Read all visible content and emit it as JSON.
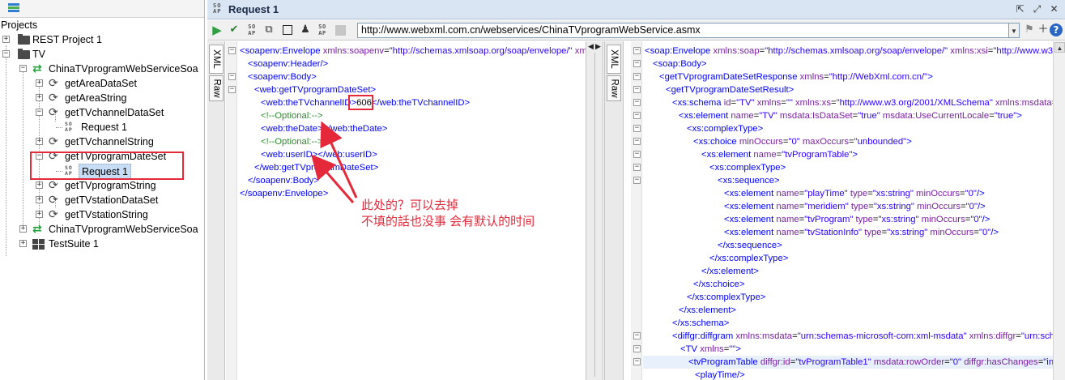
{
  "navigator": {
    "heading": "Projects",
    "items": [
      {
        "label": "REST Project 1"
      },
      {
        "label": "TV"
      },
      {
        "label": "ChinaTVprogramWebServiceSoa"
      },
      {
        "label": "getAreaDataSet"
      },
      {
        "label": "getAreaString"
      },
      {
        "label": "getTVchannelDataSet"
      },
      {
        "label": "Request 1"
      },
      {
        "label": "getTVchannelString"
      },
      {
        "label": "getTVprogramDateSet"
      },
      {
        "label": "Request 1"
      },
      {
        "label": "getTVprogramString"
      },
      {
        "label": "getTVstationDataSet"
      },
      {
        "label": "getTVstationString"
      },
      {
        "label": "ChinaTVprogramWebServiceSoa"
      },
      {
        "label": "TestSuite 1"
      }
    ]
  },
  "window": {
    "soap_badge": "SO AP",
    "title": "Request 1"
  },
  "toolbar": {
    "endpoint": "http://www.webxml.com.cn/webservices/ChinaTVprogramWebService.asmx"
  },
  "tabs": {
    "xml": "XML",
    "raw": "Raw"
  },
  "request_xml": {
    "l1": {
      "t1": "<soapenv:Envelope",
      "a1": "xmlns:soapenv",
      "v1": "\"http://schemas.xmlsoap.org/soap/envelope/\"",
      "a2": "xmlns:"
    },
    "l2": "<soapenv:Header/>",
    "l3": "<soapenv:Body>",
    "l4": "<web:getTVprogramDateSet>",
    "l5": {
      "open": "<web:theTVchannelID>",
      "value": "606",
      "close": "</web:theTVchannelID>"
    },
    "l6": "<!--Optional:-->",
    "l7": {
      "open": "<web:theDate>",
      "close": "</web:theDate>"
    },
    "l8": "<!--Optional:-->",
    "l9": {
      "open": "<web:userID>",
      "close": "</web:userID>"
    },
    "l10": "</web:getTVprogramDateSet>",
    "l11": "</soapenv:Body>",
    "l12": "</soapenv:Envelope>"
  },
  "response_xml": {
    "r1": {
      "t": "<soap:Envelope",
      "a1": "xmlns:soap",
      "v1": "\"http://schemas.xmlsoap.org/soap/envelope/\"",
      "a2": "xmlns:xsi",
      "v2": "\"http://www.w3.o"
    },
    "r2": "<soap:Body>",
    "r3": {
      "t": "<getTVprogramDateSetResponse",
      "a1": "xmlns",
      "v1": "\"http://WebXml.com.cn/\"",
      "end": ">"
    },
    "r4": "<getTVprogramDateSetResult>",
    "r5": {
      "t": "<xs:schema",
      "a1": "id",
      "v1": "\"TV\"",
      "a2": "xmlns",
      "v2": "\"\"",
      "a3": "xmlns:xs",
      "v3": "\"http://www.w3.org/2001/XMLSchema\"",
      "a4": "xmlns:msdata="
    },
    "r6": {
      "t": "<xs:element",
      "a1": "name",
      "v1": "\"TV\"",
      "a2": "msdata:IsDataSet",
      "v2": "\"true\"",
      "a3": "msdata:UseCurrentLocale",
      "v3": "\"true\"",
      "end": ">"
    },
    "r7": "<xs:complexType>",
    "r8": {
      "t": "<xs:choice",
      "a1": "minOccurs",
      "v1": "\"0\"",
      "a2": "maxOccurs",
      "v2": "\"unbounded\"",
      "end": ">"
    },
    "r9": {
      "t": "<xs:element",
      "a1": "name",
      "v1": "\"tvProgramTable\"",
      "end": ">"
    },
    "r10": "<xs:complexType>",
    "r11": "<xs:sequence>",
    "r12": {
      "t": "<xs:element",
      "a1": "name",
      "v1": "\"playTime\"",
      "a2": "type",
      "v2": "\"xs:string\"",
      "a3": "minOccurs",
      "v3": "\"0\"",
      "end": "/>"
    },
    "r13": {
      "t": "<xs:element",
      "a1": "name",
      "v1": "\"meridiem\"",
      "a2": "type",
      "v2": "\"xs:string\"",
      "a3": "minOccurs",
      "v3": "\"0\"",
      "end": "/>"
    },
    "r14": {
      "t": "<xs:element",
      "a1": "name",
      "v1": "\"tvProgram\"",
      "a2": "type",
      "v2": "\"xs:string\"",
      "a3": "minOccurs",
      "v3": "\"0\"",
      "end": "/>"
    },
    "r15": {
      "t": "<xs:element",
      "a1": "name",
      "v1": "\"tvStationInfo\"",
      "a2": "type",
      "v2": "\"xs:string\"",
      "a3": "minOccurs",
      "v3": "\"0\"",
      "end": "/>"
    },
    "r16": "</xs:sequence>",
    "r17": "</xs:complexType>",
    "r18": "</xs:element>",
    "r19": "</xs:choice>",
    "r20": "</xs:complexType>",
    "r21": "</xs:element>",
    "r22": "</xs:schema>",
    "r23": {
      "t": "<diffgr:diffgram",
      "a1": "xmlns:msdata",
      "v1": "\"urn:schemas-microsoft-com:xml-msdata\"",
      "a2": "xmlns:diffgr",
      "v2": "\"urn:sche"
    },
    "r24": {
      "t": "<TV",
      "a1": "xmlns",
      "v1": "\"\"",
      "end": ">"
    },
    "r25": {
      "t": "<tvProgramTable",
      "a1": "diffgr:id",
      "v1": "\"tvProgramTable1\"",
      "a2": "msdata:rowOrder",
      "v2": "\"0\"",
      "a3": "diffgr:hasChanges",
      "v3": "\"inse"
    },
    "r26": "<playTime/>"
  },
  "annotation": {
    "line1": "此处的？可以去掉",
    "line2": "不填的話也没事 会有默认的时间"
  },
  "colors": {
    "highlight": "#e5283a",
    "tag": "#0000ff",
    "comment": "#2e8b2e"
  }
}
